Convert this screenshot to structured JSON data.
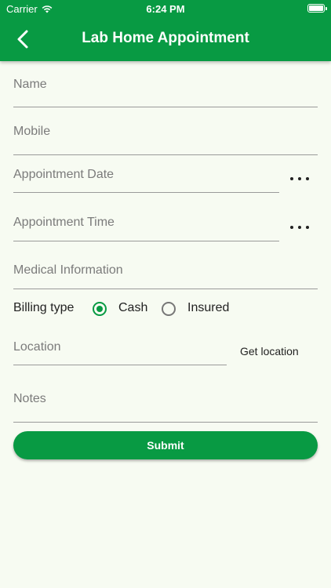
{
  "status_bar": {
    "carrier": "Carrier",
    "time": "6:24 PM"
  },
  "header": {
    "title": "Lab Home Appointment"
  },
  "form": {
    "name_label": "Name",
    "mobile_label": "Mobile",
    "appointment_date_label": "Appointment Date",
    "appointment_time_label": "Appointment Time",
    "medical_info_label": "Medical Information",
    "billing_type_label": "Billing type",
    "billing_options": [
      "Cash",
      "Insured"
    ],
    "billing_selected": "Cash",
    "location_label": "Location",
    "get_location_label": "Get location",
    "notes_label": "Notes",
    "submit_label": "Submit"
  },
  "colors": {
    "primary": "#089a43",
    "background": "#f7fbf2"
  }
}
